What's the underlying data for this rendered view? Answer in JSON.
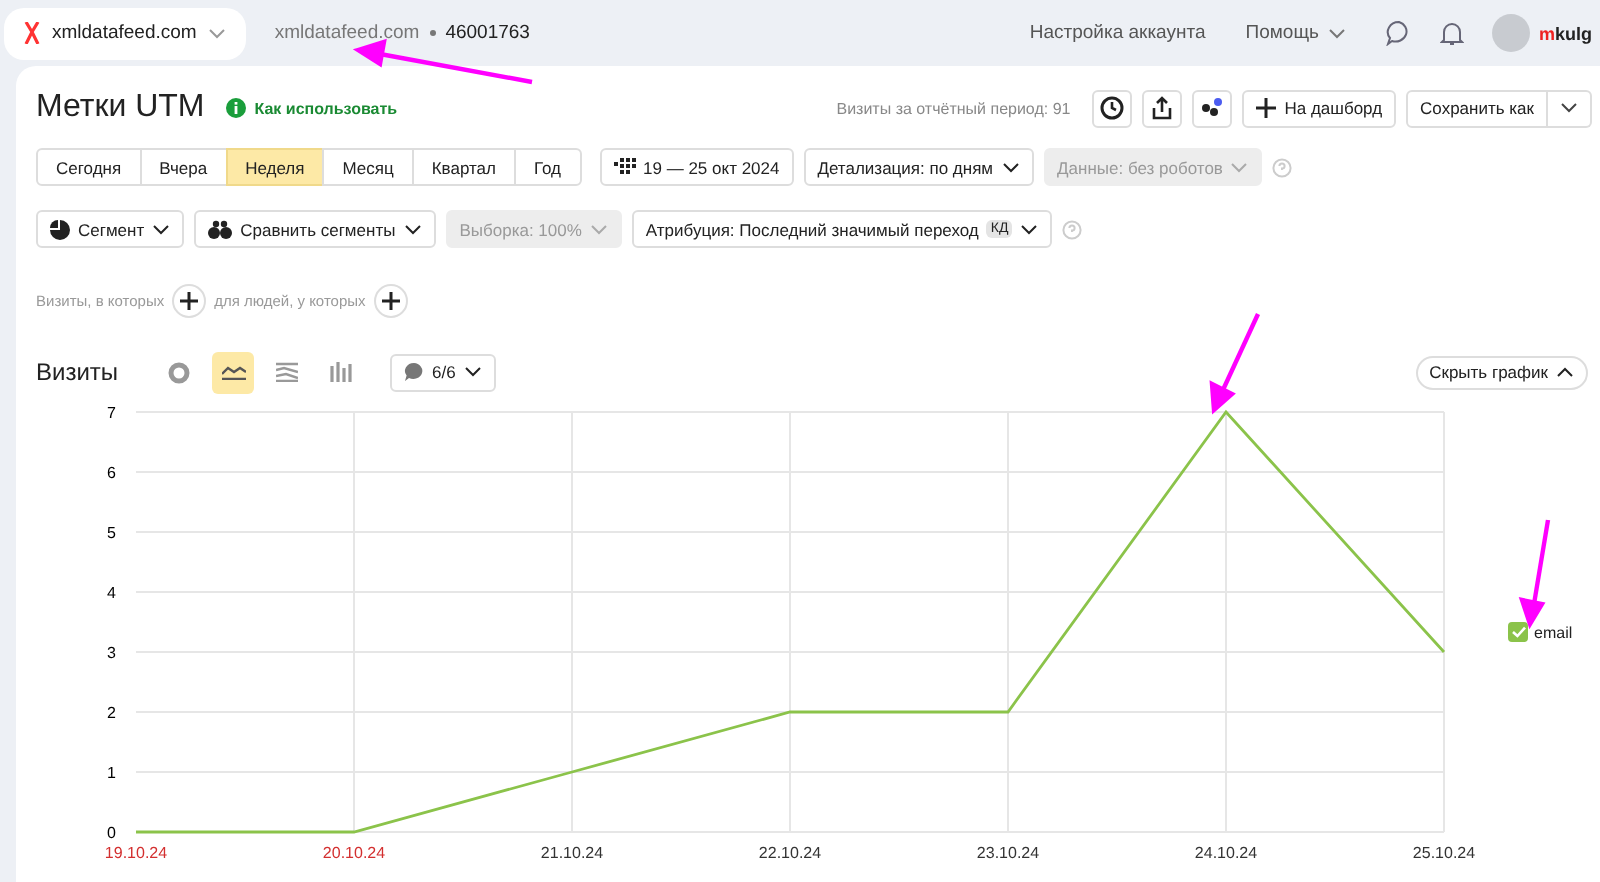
{
  "topbar": {
    "counter_site": "xmldatafeed.com",
    "site": "xmldatafeed.com",
    "counter_id": "46001763",
    "links": [
      "Настройка аккаунта",
      "Помощь"
    ],
    "user": "mkulg"
  },
  "header": {
    "title": "Метки UTM",
    "help_link": "Как использовать",
    "visits_total": "Визиты за отчётный период: 91",
    "dashboard_button": "На дашборд",
    "save_button": "Сохранить как"
  },
  "periods": [
    {
      "label": "Сегодня",
      "selected": false
    },
    {
      "label": "Вчера",
      "selected": false
    },
    {
      "label": "Неделя",
      "selected": true
    },
    {
      "label": "Месяц",
      "selected": false
    },
    {
      "label": "Квартал",
      "selected": false
    },
    {
      "label": "Год",
      "selected": false
    }
  ],
  "date_range": "19 — 25 окт 2024",
  "detail": "Детализация: по дням",
  "data_filter": {
    "label": "Данные: без роботов",
    "disabled": true
  },
  "segment": "Сегмент",
  "compare": "Сравнить сегменты",
  "sample": {
    "label": "Выборка: 100%",
    "disabled": true
  },
  "attribution": "Атрибуция: Последний значимый переход",
  "attribution_badge": "КД",
  "conditions": [
    "Визиты, в которых",
    "для людей, у которых"
  ],
  "chart_header": {
    "title": "Визиты",
    "chart_types": [
      {
        "kind": "pie",
        "selected": false
      },
      {
        "kind": "line",
        "selected": true
      },
      {
        "kind": "area",
        "selected": false
      },
      {
        "kind": "bar",
        "selected": false
      }
    ],
    "annotations": "6/6",
    "hide_button": "Скрыть график"
  },
  "chart": {
    "legend": [
      {
        "checked": true
      }
    ],
    "weekend": [
      true,
      true,
      false,
      false,
      false,
      false,
      false
    ],
    "chart_data": {
      "type": "line",
      "grid": true,
      "categories": [
        "19.10.24",
        "20.10.24",
        "21.10.24",
        "22.10.24",
        "23.10.24",
        "24.10.24",
        "25.10.24"
      ],
      "series": [
        {
          "name": "email",
          "color": "#8bc34a",
          "values": [
            0,
            0,
            1,
            2,
            2,
            7,
            3
          ]
        }
      ],
      "ylim": [
        0,
        7
      ],
      "yticks": [
        0,
        1,
        2,
        3,
        4,
        5,
        6,
        7
      ]
    }
  }
}
